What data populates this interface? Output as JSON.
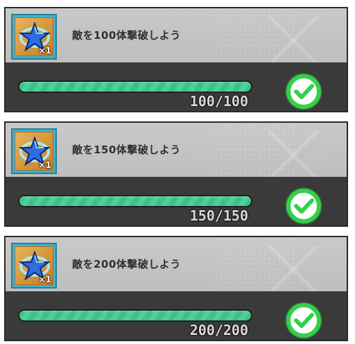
{
  "missions": [
    {
      "title": "敵を100体撃破しよう",
      "reward_count": "×1",
      "progress_text": "100/100",
      "progress": 1.0,
      "status_icon": "check-circle-icon"
    },
    {
      "title": "敵を150体撃破しよう",
      "reward_count": "×1",
      "progress_text": "150/150",
      "progress": 1.0,
      "status_icon": "check-circle-icon"
    },
    {
      "title": "敵を200体撃破しよう",
      "reward_count": "×1",
      "progress_text": "200/200",
      "progress": 1.0,
      "status_icon": "check-circle-icon"
    }
  ],
  "colors": {
    "progress_fill": "#3fbf8a",
    "check_green": "#35d04a",
    "panel_dark": "#3a3a3a",
    "panel_light": "#c6c6c6"
  }
}
